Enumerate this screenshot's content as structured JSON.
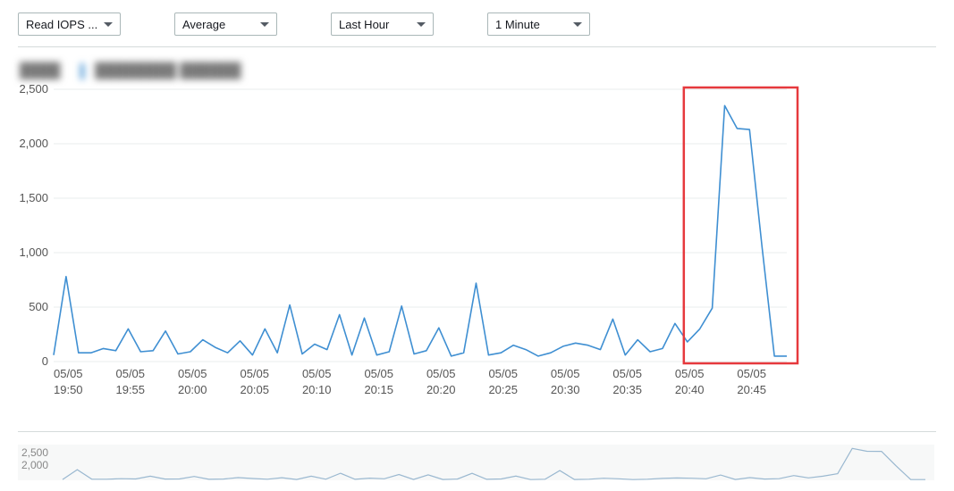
{
  "toolbar": {
    "metric": {
      "label": "Read IOPS ..."
    },
    "stat": {
      "label": "Average"
    },
    "range": {
      "label": "Last Hour"
    },
    "period": {
      "label": "1 Minute"
    }
  },
  "legend": {
    "item1": "████",
    "item2": "████████ ██████"
  },
  "mini": {
    "ytick1": "2,500",
    "ytick2": "2,000"
  },
  "chart_data": {
    "type": "line",
    "title": "",
    "xlabel": "",
    "ylabel": "",
    "ylim": [
      0,
      2500
    ],
    "y_ticks": [
      0,
      500,
      1000,
      1500,
      2000,
      2500
    ],
    "y_tick_labels": [
      "0",
      "500",
      "1,000",
      "1,500",
      "2,000",
      "2,500"
    ],
    "x_tick_indices": [
      0,
      5,
      10,
      15,
      20,
      25,
      30,
      35,
      40,
      45,
      50,
      55
    ],
    "x_tick_labels": [
      [
        "05/05",
        "19:50"
      ],
      [
        "05/05",
        "19:55"
      ],
      [
        "05/05",
        "20:00"
      ],
      [
        "05/05",
        "20:05"
      ],
      [
        "05/05",
        "20:10"
      ],
      [
        "05/05",
        "20:15"
      ],
      [
        "05/05",
        "20:20"
      ],
      [
        "05/05",
        "20:25"
      ],
      [
        "05/05",
        "20:30"
      ],
      [
        "05/05",
        "20:35"
      ],
      [
        "05/05",
        "20:40"
      ],
      [
        "05/05",
        "20:45"
      ]
    ],
    "highlight_indices": [
      51,
      60
    ],
    "categories_minutes_from_1950": [
      0,
      1,
      2,
      3,
      4,
      5,
      6,
      7,
      8,
      9,
      10,
      11,
      12,
      13,
      14,
      15,
      16,
      17,
      18,
      19,
      20,
      21,
      22,
      23,
      24,
      25,
      26,
      27,
      28,
      29,
      30,
      31,
      32,
      33,
      34,
      35,
      36,
      37,
      38,
      39,
      40,
      41,
      42,
      43,
      44,
      45,
      46,
      47,
      48,
      49,
      50,
      51,
      52,
      53,
      54,
      55,
      56,
      57,
      58,
      59
    ],
    "series": [
      {
        "name": "Read IOPS",
        "color": "#3f8fd2",
        "values": [
          60,
          780,
          80,
          80,
          120,
          100,
          300,
          90,
          100,
          280,
          70,
          90,
          200,
          130,
          80,
          190,
          60,
          300,
          80,
          520,
          70,
          160,
          110,
          430,
          60,
          400,
          60,
          90,
          510,
          70,
          100,
          310,
          50,
          80,
          720,
          60,
          80,
          150,
          110,
          50,
          80,
          140,
          170,
          150,
          110,
          390,
          60,
          200,
          90,
          120,
          350,
          180,
          300,
          490,
          2350,
          2140,
          2130,
          1060,
          50,
          50
        ]
      }
    ]
  }
}
